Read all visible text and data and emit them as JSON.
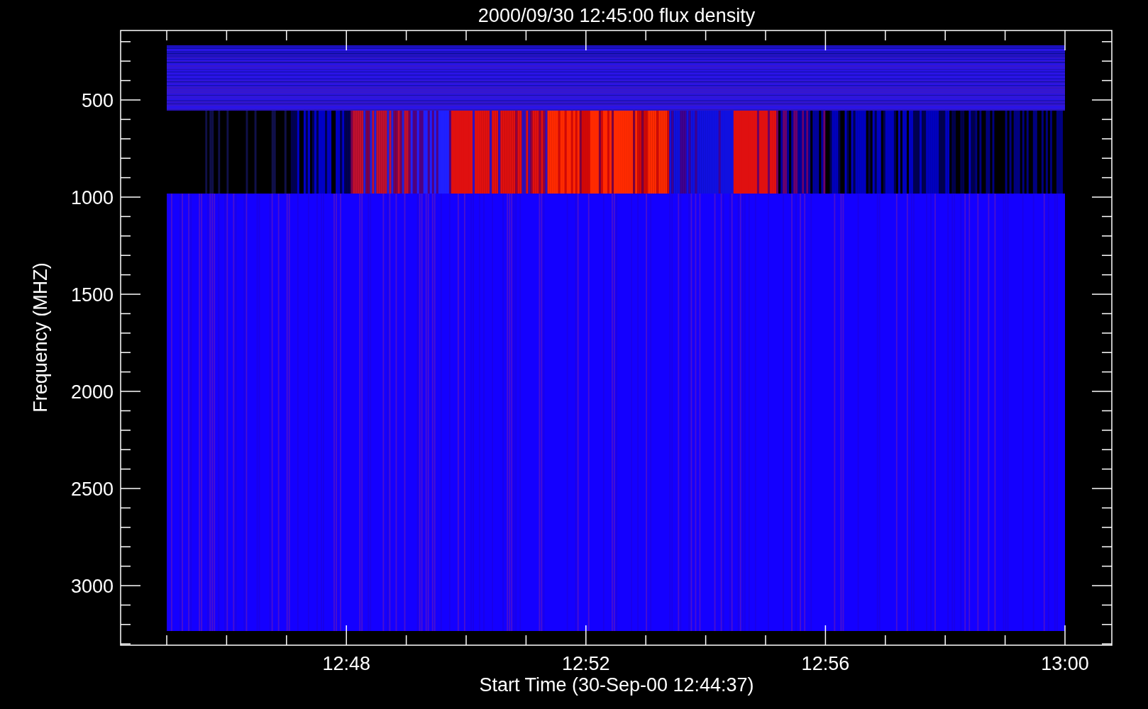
{
  "plot": {
    "title": "2000/09/30 12:45:00 flux density",
    "y_axis": {
      "label": "Frequency (MHZ)",
      "ticks": [
        "500",
        "1000",
        "1500",
        "2000",
        "2500",
        "3000"
      ]
    },
    "x_axis": {
      "label": "Start Time (30-Sep-00 12:44:37)",
      "ticks": [
        "12:48",
        "12:52",
        "12:56",
        "13:00"
      ]
    }
  }
}
